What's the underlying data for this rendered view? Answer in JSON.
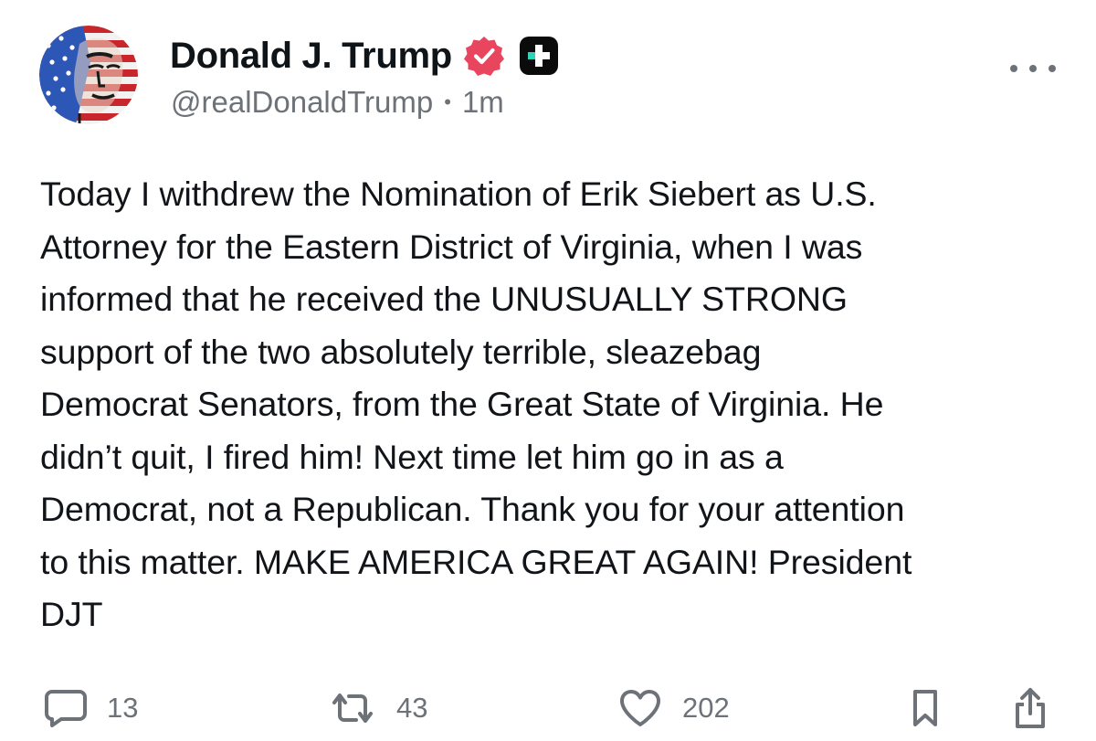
{
  "author": {
    "display_name": "Donald J. Trump",
    "handle": "@realDonaldTrump",
    "separator": "•",
    "time_ago": "1m",
    "avatar_icon": "flag-portrait-avatar",
    "verified_icon": "verified-badge-icon",
    "plus_icon": "plus-badge-icon"
  },
  "post": {
    "text": "Today I withdrew the Nomination of Erik Siebert as U.S.\nAttorney for the Eastern District of Virginia, when I was\ninformed that he received the UNUSUALLY STRONG\nsupport of the two absolutely terrible, sleazebag\nDemocrat Senators, from the Great State of Virginia. He\ndidn’t quit, I fired him! Next time let him go in as a\nDemocrat, not a Republican. Thank you for your attention\nto this matter. MAKE AMERICA GREAT AGAIN! President\nDJT"
  },
  "actions": {
    "replies": "13",
    "reposts": "43",
    "likes": "202"
  },
  "colors": {
    "text": "#111418",
    "muted": "#6c7278",
    "verified": "#e8455f",
    "plus_badge_bg": "#0b0b0b",
    "plus_badge_accent": "#2fd3b5"
  }
}
